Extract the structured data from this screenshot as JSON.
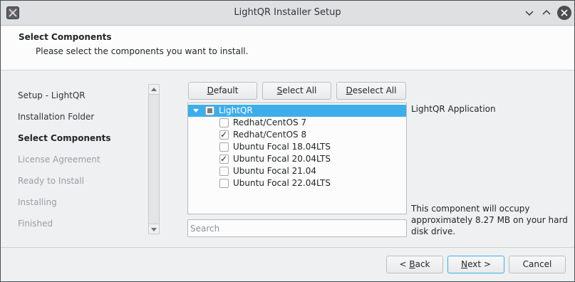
{
  "window": {
    "title": "LightQR Installer Setup"
  },
  "header": {
    "title": "Select Components",
    "subtitle": "Please select the components you want to install."
  },
  "steps": [
    {
      "label": "Setup - LightQR",
      "state": "done"
    },
    {
      "label": "Installation Folder",
      "state": "done"
    },
    {
      "label": "Select Components",
      "state": "active"
    },
    {
      "label": "License Agreement",
      "state": "pending"
    },
    {
      "label": "Ready to Install",
      "state": "pending"
    },
    {
      "label": "Installing",
      "state": "pending"
    },
    {
      "label": "Finished",
      "state": "pending"
    }
  ],
  "buttons": {
    "default": {
      "pre": "",
      "key": "D",
      "post": "efault"
    },
    "select_all": {
      "pre": "",
      "key": "S",
      "post": "elect All"
    },
    "deselect_all": {
      "pre": "",
      "key": "D",
      "post": "eselect All"
    },
    "back": {
      "pre": "< ",
      "key": "B",
      "post": "ack"
    },
    "next": {
      "pre": "",
      "key": "N",
      "post": "ext >"
    },
    "cancel": "Cancel"
  },
  "tree": {
    "root": {
      "label": "LightQR",
      "state": "partial",
      "expanded": true
    },
    "children": [
      {
        "label": "Redhat/CentOS 7",
        "checked": false
      },
      {
        "label": "Redhat/CentOS 8",
        "checked": true
      },
      {
        "label": "Ubuntu Focal 18.04LTS",
        "checked": false
      },
      {
        "label": "Ubuntu Focal 20.04LTS",
        "checked": true
      },
      {
        "label": "Ubuntu Focal 21.04",
        "checked": false
      },
      {
        "label": "Ubuntu Focal 22.04LTS",
        "checked": false
      }
    ]
  },
  "search": {
    "placeholder": "Search",
    "value": ""
  },
  "description": {
    "title": "LightQR Application",
    "size_text": "This component will occupy approximately 8.27 MB on your hard disk drive."
  },
  "colors": {
    "accent": "#3daee9",
    "window_bg": "#eff0f1",
    "header_bg": "#fcfcfc"
  }
}
